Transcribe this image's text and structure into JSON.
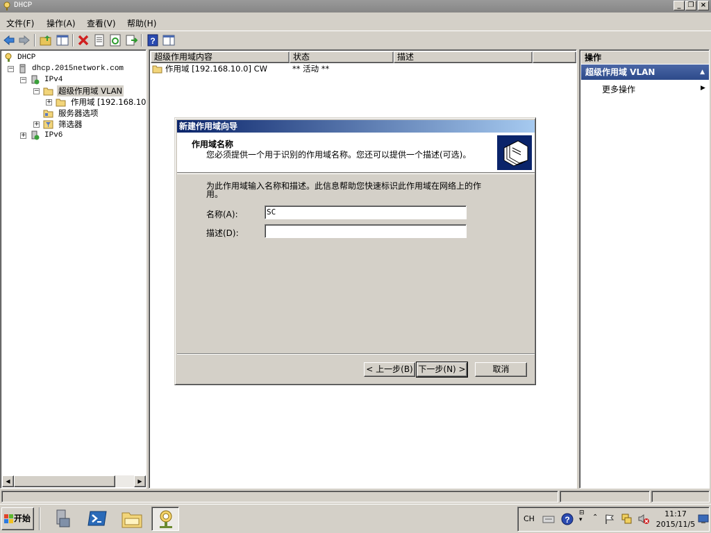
{
  "window": {
    "title": "DHCP"
  },
  "menu": [
    "文件(F)",
    "操作(A)",
    "查看(V)",
    "帮助(H)"
  ],
  "toolbar": {
    "icons": [
      "back-icon",
      "forward-icon",
      "up-folder-icon",
      "show-tree-icon",
      "delete-icon",
      "properties-icon",
      "refresh-icon",
      "export-icon",
      "help-icon",
      "show-action-pane-icon"
    ]
  },
  "tree": {
    "root": "DHCP",
    "server": "dhcp.2015network.com",
    "ipv4": "IPv4",
    "superscope": "超级作用域 VLAN",
    "scope": "作用域 [192.168.10",
    "server_options": "服务器选项",
    "filters": "筛选器",
    "ipv6": "IPv6"
  },
  "list": {
    "columns": [
      "超级作用域内容",
      "状态",
      "描述"
    ],
    "rows": [
      {
        "name": "作用域 [192.168.10.0] CW",
        "status": "** 活动 **",
        "desc": ""
      }
    ]
  },
  "actions": {
    "header": "操作",
    "section": "超级作用域 VLAN",
    "more": "更多操作"
  },
  "taskbar": {
    "start": "开始",
    "tray": {
      "lang": "CH",
      "time": "11:17",
      "date": "2015/11/5"
    }
  },
  "dialog": {
    "title": "新建作用域向导",
    "header_title": "作用域名称",
    "header_sub": "您必须提供一个用于识别的作用域名称。您还可以提供一个描述(可选)。",
    "instruction": "为此作用域输入名称和描述。此信息帮助您快速标识此作用域在网络上的作用。",
    "name_label": "名称(A):",
    "name_value": "SC",
    "desc_label": "描述(D):",
    "desc_value": "",
    "back": "< 上一步(B)",
    "next": "下一步(N) >",
    "cancel": "取消"
  }
}
